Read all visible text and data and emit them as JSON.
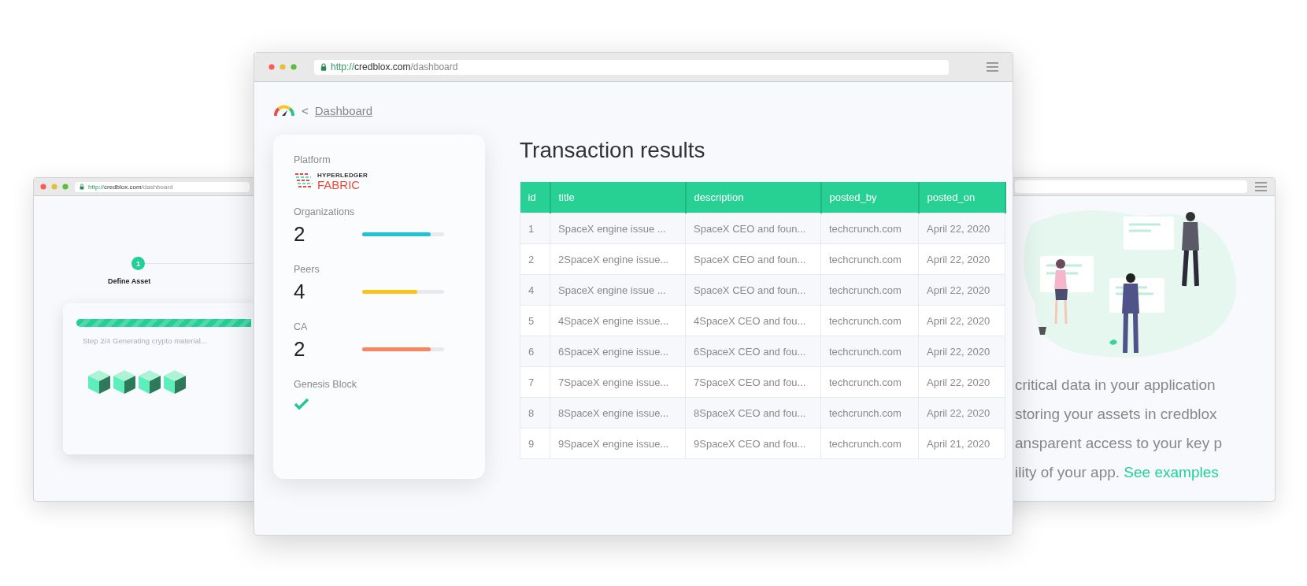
{
  "left_window": {
    "url": {
      "scheme": "http://",
      "host": "credblox.com",
      "path": "/dashboard"
    },
    "step": {
      "number": "1",
      "label": "Define Asset"
    },
    "progress": {
      "level": 1
    },
    "status": "Step 2/4 Generating crypto material..."
  },
  "main_window": {
    "url": {
      "scheme": "http://",
      "host": "credblox.com",
      "path": "/dashboard"
    },
    "breadcrumb": {
      "back": "<",
      "link": "Dashboard"
    },
    "card": {
      "platform_label": "Platform",
      "platform_logo": {
        "line1": "HYPERLEDGER",
        "line2": "FABRIC"
      },
      "metrics": [
        {
          "label": "Organizations",
          "value": "2",
          "level": 0.84,
          "color": "#1fc3d3"
        },
        {
          "label": "Peers",
          "value": "4",
          "level": 0.67,
          "color": "#f9c51b"
        },
        {
          "label": "CA",
          "value": "2",
          "level": 0.84,
          "color": "#fb8560"
        }
      ],
      "genesis": {
        "label": "Genesis Block",
        "checked": true
      }
    },
    "title": "Transaction results",
    "table": {
      "columns": [
        "id",
        "title",
        "description",
        "posted_by",
        "posted_on"
      ],
      "rows": [
        [
          "1",
          "SpaceX engine issue ...",
          "SpaceX CEO and foun...",
          "techcrunch.com",
          "April 22, 2020"
        ],
        [
          "2",
          "2SpaceX engine issue...",
          "SpaceX CEO and foun...",
          "techcrunch.com",
          "April 22, 2020"
        ],
        [
          "4",
          "SpaceX engine issue ...",
          "SpaceX CEO and foun...",
          "techcrunch.com",
          "April 22, 2020"
        ],
        [
          "5",
          "4SpaceX engine issue...",
          "4SpaceX CEO and fou...",
          "techcrunch.com",
          "April 22, 2020"
        ],
        [
          "6",
          "6SpaceX engine issue...",
          "6SpaceX CEO and fou...",
          "techcrunch.com",
          "April 22, 2020"
        ],
        [
          "7",
          "7SpaceX engine issue...",
          "7SpaceX CEO and fou...",
          "techcrunch.com",
          "April 22, 2020"
        ],
        [
          "8",
          "8SpaceX engine issue...",
          "8SpaceX CEO and fou...",
          "techcrunch.com",
          "April 22, 2020"
        ],
        [
          "9",
          "9SpaceX engine issue...",
          "9SpaceX CEO and fou...",
          "techcrunch.com",
          "April 21, 2020"
        ]
      ]
    }
  },
  "right_window": {
    "text_lines": [
      "critical data in your application",
      "storing your assets in credblox",
      "ansparent access to your key p",
      "ility of your app."
    ],
    "link": "See examples"
  }
}
